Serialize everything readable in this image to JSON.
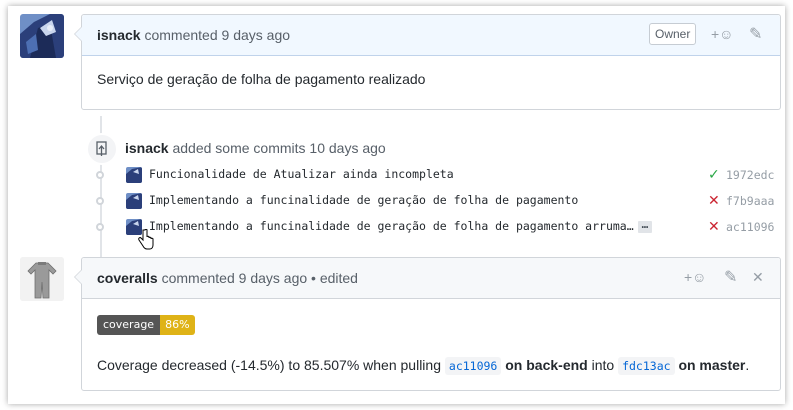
{
  "comment1": {
    "author": "isnack",
    "action": "commented 9 days ago",
    "badge": "Owner",
    "body": "Serviço de geração de folha de pagamento realizado"
  },
  "event": {
    "author": "isnack",
    "action": "added some commits 10 days ago",
    "commits": [
      {
        "message": "Funcionalidade de Atualizar ainda incompleta",
        "status": "✓",
        "sha": "1972edc"
      },
      {
        "message": "Implementando a funcinalidade de geração de folha de pagamento",
        "status": "✕",
        "sha": "f7b9aaa"
      },
      {
        "message": "Implementando a funcinalidade de geração de folha de pagamento arruma…",
        "ellipsis": "…",
        "status": "✕",
        "sha": "ac11096"
      }
    ]
  },
  "comment2": {
    "author": "coveralls",
    "action": "commented 9 days ago • edited",
    "coverage_label": "coverage",
    "coverage_value": "86%",
    "text1": "Coverage decreased (-14.5%) to 85.507% when pulling",
    "sha1": "ac11096",
    "text2": "on back-end",
    "text3": "into",
    "sha2": "fdc13ac",
    "text4": "on master",
    "text5": "."
  },
  "icons": {
    "reaction": "+☺",
    "edit": "✎",
    "close": "✕"
  },
  "colors": {
    "success": "#28a745",
    "failure": "#cb2431",
    "coverage": "#dfb317",
    "link": "#0366d6"
  }
}
